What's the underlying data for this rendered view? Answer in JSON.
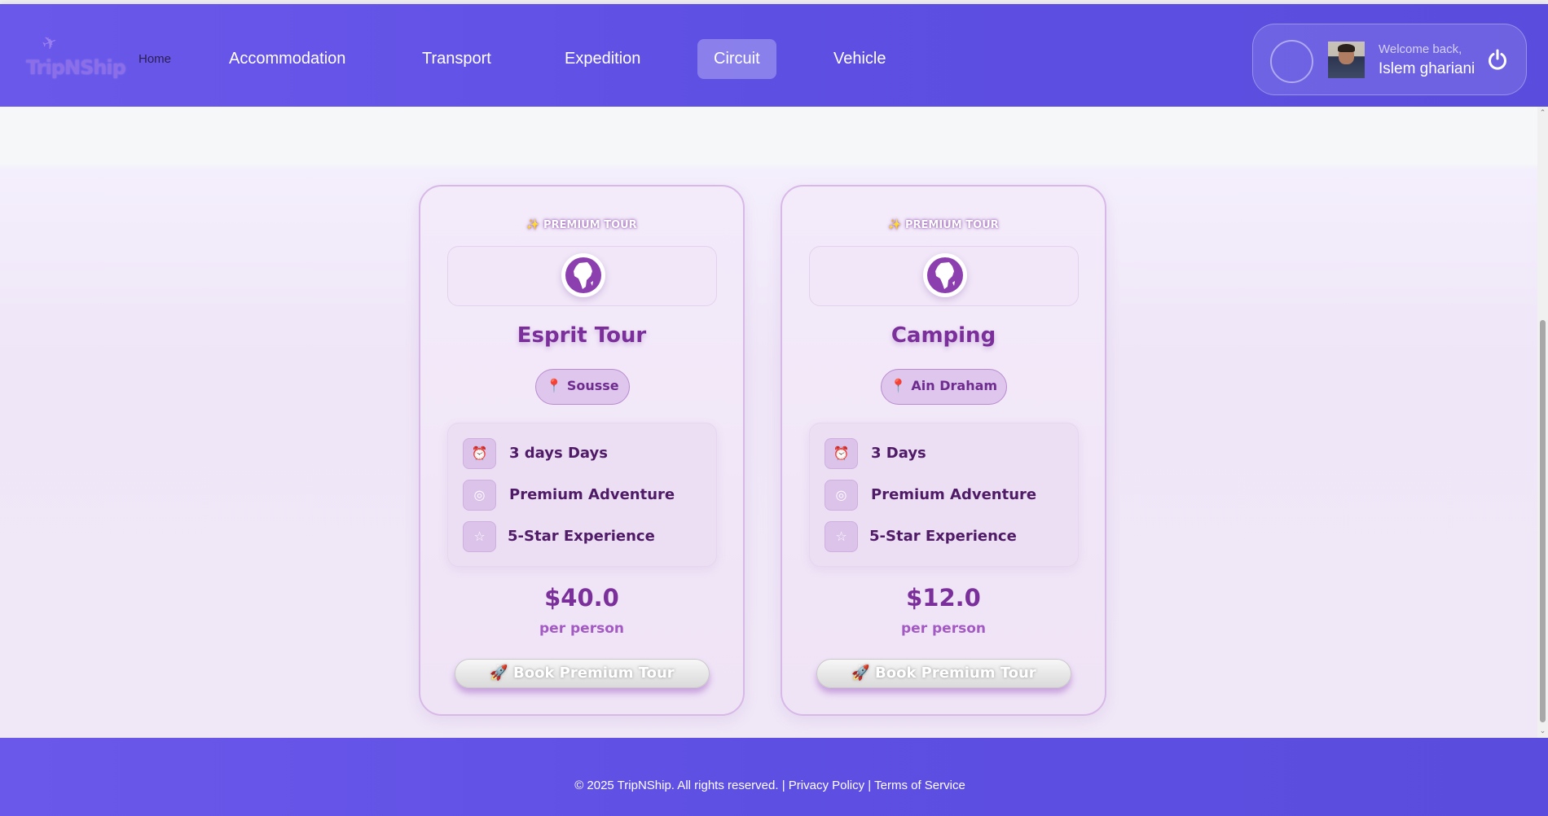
{
  "header": {
    "logo_text": "TripNShip",
    "nav": [
      {
        "label": "Home"
      },
      {
        "label": "Accommodation"
      },
      {
        "label": "Transport"
      },
      {
        "label": "Expedition"
      },
      {
        "label": "Circuit",
        "active": true
      },
      {
        "label": "Vehicle"
      }
    ],
    "user": {
      "welcome": "Welcome back,",
      "name": "Islem ghariani",
      "logout_icon": "power-icon"
    }
  },
  "cards": [
    {
      "badge": "✨ PREMIUM TOUR",
      "icon": "globe-icon",
      "title": "Esprit Tour",
      "location": "📍 Sousse",
      "features": [
        {
          "icon": "alarm-clock-icon",
          "text": "3 days Days"
        },
        {
          "icon": "target-icon",
          "text": "Premium Adventure"
        },
        {
          "icon": "star-icon",
          "text": "5-Star Experience"
        }
      ],
      "price": "$40.0",
      "price_unit": "per person",
      "button": "🚀 Book Premium Tour"
    },
    {
      "badge": "✨ PREMIUM TOUR",
      "icon": "globe-icon",
      "title": "Camping",
      "location": "📍 Ain Draham",
      "features": [
        {
          "icon": "alarm-clock-icon",
          "text": "3 Days"
        },
        {
          "icon": "target-icon",
          "text": "Premium Adventure"
        },
        {
          "icon": "star-icon",
          "text": "5-Star Experience"
        }
      ],
      "price": "$12.0",
      "price_unit": "per person",
      "button": "🚀 Book Premium Tour"
    }
  ],
  "footer": {
    "copyright": "© 2025 TripNShip. All rights reserved. |",
    "privacy": "Privacy Policy",
    "separator": "|",
    "terms": "Terms of Service"
  },
  "colors": {
    "header": "#5e4fe3",
    "accent": "#7a2f9a",
    "card_border": "#d7b8e6"
  }
}
